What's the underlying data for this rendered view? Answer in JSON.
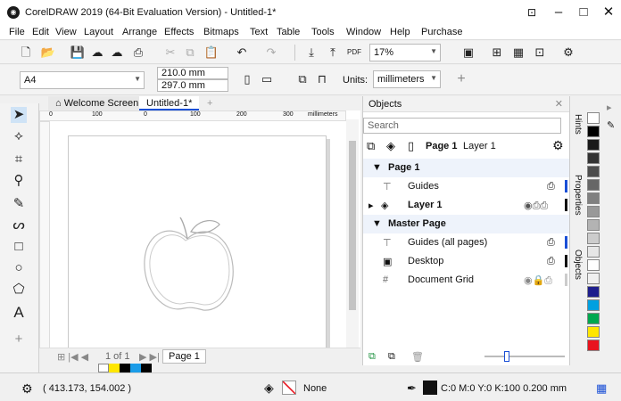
{
  "window": {
    "title": "CorelDRAW 2019 (64-Bit Evaluation Version) - Untitled-1*",
    "app_icon": "coreldraw-logo-icon",
    "minimize": "–",
    "maximize": "□",
    "close": "✕"
  },
  "menu": [
    "File",
    "Edit",
    "View",
    "Layout",
    "Arrange",
    "Effects",
    "Bitmaps",
    "Text",
    "Table",
    "Tools",
    "Window",
    "Help",
    "Purchase"
  ],
  "toolbar": {
    "zoom": "17%"
  },
  "property_bar": {
    "page_size": "A4",
    "width": "210.0 mm",
    "height": "297.0 mm",
    "units_label": "Units:",
    "units": "millimeters"
  },
  "tabs": {
    "welcome": "Welcome Screen",
    "document": "Untitled-1*",
    "add": "+"
  },
  "ruler": {
    "ticks": [
      "0",
      "100",
      "0",
      "100",
      "200",
      "300"
    ],
    "unit": "millimeters"
  },
  "page_nav": {
    "info": "1 of 1",
    "page_tab": "Page 1"
  },
  "objects": {
    "title": "Objects",
    "search_placeholder": "Search",
    "current_page": "Page 1",
    "current_layer": "Layer 1",
    "rows": [
      {
        "label": "Page 1",
        "type": "header"
      },
      {
        "label": "Guides",
        "type": "item"
      },
      {
        "label": "Layer 1",
        "type": "item"
      },
      {
        "label": "Master Page",
        "type": "header"
      },
      {
        "label": "Guides (all pages)",
        "type": "item"
      },
      {
        "label": "Desktop",
        "type": "item"
      },
      {
        "label": "Document Grid",
        "type": "item"
      }
    ]
  },
  "side_tabs": [
    "Hints",
    "Properties",
    "Objects"
  ],
  "status": {
    "coords": "( 413.173, 154.002 )",
    "fill": "None",
    "outline": "C:0 M:0 Y:0 K:100  0.200 mm"
  },
  "colors": {
    "accent": "#1a4fd6",
    "layer_bar": "#1a4fd6"
  },
  "palette": [
    "#ffffff",
    "#000000",
    "#1a1a1a",
    "#333333",
    "#4d4d4d",
    "#666666",
    "#808080",
    "#999999",
    "#b3b3b3",
    "#cccccc",
    "#e6e6e6",
    "#ffffff",
    "#f0f0f0",
    "#1e1e8c",
    "#00a0e0",
    "#00a84f",
    "#ffe600",
    "#e8141e"
  ]
}
